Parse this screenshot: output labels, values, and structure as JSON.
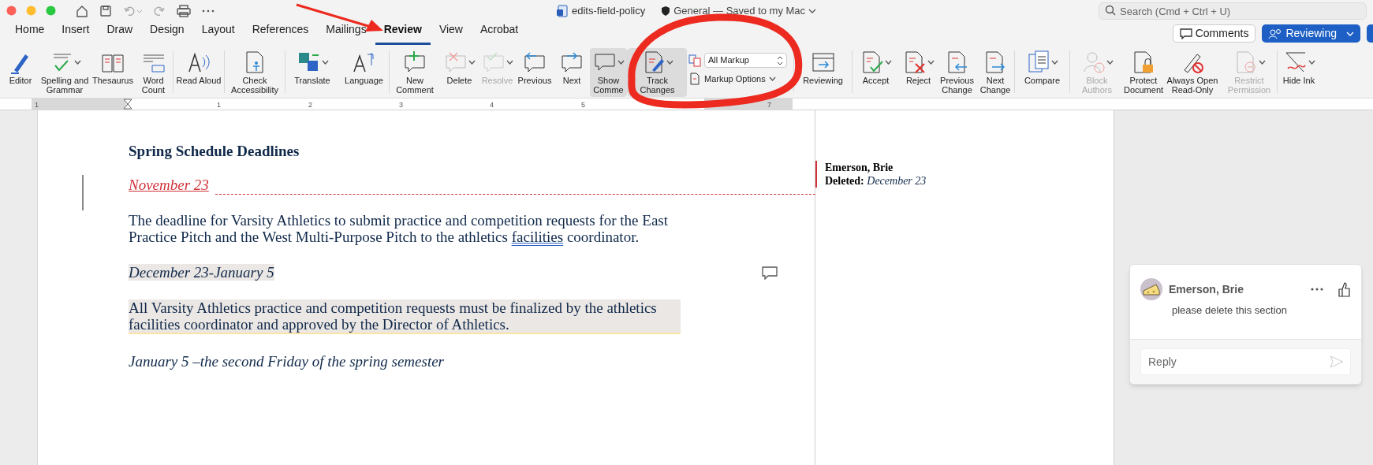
{
  "title_bar": {
    "document": "edits-field-policy",
    "status": "General — Saved to my Mac",
    "search": {
      "placeholder": "Search (Cmd + Ctrl + U)"
    }
  },
  "tabs": [
    {
      "label": "Home",
      "selected": false
    },
    {
      "label": "Insert",
      "selected": false
    },
    {
      "label": "Draw",
      "selected": false
    },
    {
      "label": "Design",
      "selected": false
    },
    {
      "label": "Layout",
      "selected": false
    },
    {
      "label": "References",
      "selected": false
    },
    {
      "label": "Mailings",
      "selected": false
    },
    {
      "label": "Review",
      "selected": true
    },
    {
      "label": "View",
      "selected": false
    },
    {
      "label": "Acrobat",
      "selected": false
    }
  ],
  "header_buttons": [
    {
      "label": "Comments",
      "kind": "outline"
    },
    {
      "label": "Reviewing",
      "kind": "primary"
    }
  ],
  "ribbon": [
    {
      "label": "Editor",
      "disabled": false,
      "pressed": false
    },
    {
      "label": "Spelling and Grammar",
      "disabled": false,
      "pressed": false
    },
    {
      "label": "Thesaurus",
      "disabled": false,
      "pressed": false
    },
    {
      "label": "Word Count",
      "disabled": false,
      "pressed": false
    },
    {
      "label": "Read Aloud",
      "disabled": false,
      "pressed": false
    },
    {
      "label": "Check Accessibility",
      "disabled": false,
      "pressed": false
    },
    {
      "label": "Translate",
      "disabled": false,
      "pressed": false
    },
    {
      "label": "Language",
      "disabled": false,
      "pressed": false
    },
    {
      "label": "New Comment",
      "disabled": false,
      "pressed": false
    },
    {
      "label": "Delete",
      "disabled": false,
      "pressed": false
    },
    {
      "label": "Resolve",
      "disabled": true,
      "pressed": false
    },
    {
      "label": "Previous",
      "disabled": false,
      "pressed": false
    },
    {
      "label": "Next",
      "disabled": false,
      "pressed": false
    },
    {
      "label": "Show Comme",
      "disabled": false,
      "pressed": true
    },
    {
      "label": "Track Changes",
      "disabled": false,
      "pressed": true
    },
    {
      "label": "Reviewing",
      "disabled": false,
      "pressed": false
    },
    {
      "label": "Accept",
      "disabled": false,
      "pressed": false
    },
    {
      "label": "Reject",
      "disabled": false,
      "pressed": false
    },
    {
      "label": "Previous Change",
      "disabled": false,
      "pressed": false
    },
    {
      "label": "Next Change",
      "disabled": false,
      "pressed": false
    },
    {
      "label": "Compare",
      "disabled": false,
      "pressed": false
    },
    {
      "label": "Block Authors",
      "disabled": true,
      "pressed": false
    },
    {
      "label": "Protect Document",
      "disabled": false,
      "pressed": false
    },
    {
      "label": "Always Open Read-Only",
      "disabled": false,
      "pressed": false
    },
    {
      "label": "Restrict Permission",
      "disabled": true,
      "pressed": false
    },
    {
      "label": "Hide Ink",
      "disabled": false,
      "pressed": false
    }
  ],
  "markup": {
    "dropdown": "All Markup",
    "options": "Markup Options"
  },
  "ruler_numbers": [
    "1",
    "1",
    "2",
    "3",
    "4",
    "5",
    "7"
  ],
  "document": [
    {
      "kind": "heading",
      "parts": [
        {
          "text": "Spring Schedule Deadlines",
          "flagged": false
        }
      ]
    },
    {
      "kind": "inserted",
      "parts": [
        {
          "text": "November 23",
          "flagged": false
        }
      ]
    },
    {
      "kind": "body",
      "parts": [
        {
          "text": "The deadline for Varsity Athletics to submit practice and competition requests for the East Practice Pitch and the West Multi-Purpose Pitch to the athletics ",
          "flagged": false
        },
        {
          "text": "facilities",
          "flagged": true
        },
        {
          "text": " coordinator.",
          "flagged": false
        }
      ]
    },
    {
      "kind": "commented-date",
      "parts": [
        {
          "text": "December 23-January 5",
          "flagged": false
        }
      ]
    },
    {
      "kind": "commented-body",
      "parts": [
        {
          "text": "All Varsity Athletics practice and competition requests must be finalized by the athletics facilities coordinator and approved by the Director of Athletics.",
          "flagged": false
        }
      ]
    },
    {
      "kind": "date",
      "parts": [
        {
          "text": "January 5 –the second Friday of the spring semester",
          "flagged": false
        }
      ]
    }
  ],
  "revision_balloon": {
    "author": "Emerson, Brie",
    "change": "**Deleted:** *December 23*"
  },
  "comment": {
    "author": "Emerson, Brie",
    "text": "please delete this section",
    "reply": {
      "placeholder": "Reply"
    }
  }
}
